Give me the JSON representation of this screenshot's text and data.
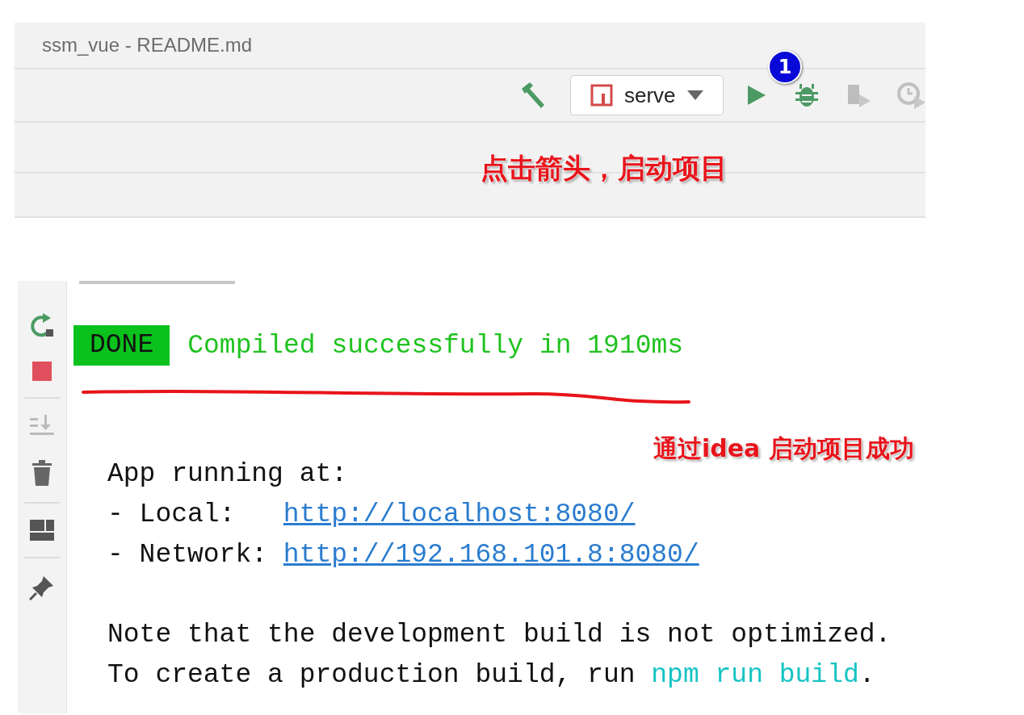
{
  "window": {
    "title": "ssm_vue - README.md"
  },
  "toolbar": {
    "run_config": "serve",
    "step_badge": "1"
  },
  "annotations": [
    {
      "text": "点击箭头，启动项目"
    },
    {
      "text": "通过idea 启动项目成功"
    }
  ],
  "console": {
    "status": "DONE",
    "message": "Compiled successfully in 1910ms",
    "paragraphs": [
      {
        "lines": [
          {
            "segments": [
              {
                "kind": "text",
                "text": "App running at:"
              }
            ]
          },
          {
            "segments": [
              {
                "kind": "text",
                "text": "- Local:   "
              },
              {
                "kind": "link",
                "text": "http://localhost:8080/"
              }
            ]
          },
          {
            "segments": [
              {
                "kind": "text",
                "text": "- Network: "
              },
              {
                "kind": "link",
                "text": "http://192.168.101.8:8080/"
              }
            ]
          }
        ]
      },
      {
        "lines": [
          {
            "segments": [
              {
                "kind": "text",
                "text": "Note that the development build is not optimized."
              }
            ]
          },
          {
            "segments": [
              {
                "kind": "text",
                "text": "To create a production build, run "
              },
              {
                "kind": "command",
                "text": "npm run build"
              },
              {
                "kind": "text",
                "text": "."
              }
            ]
          }
        ]
      }
    ]
  }
}
